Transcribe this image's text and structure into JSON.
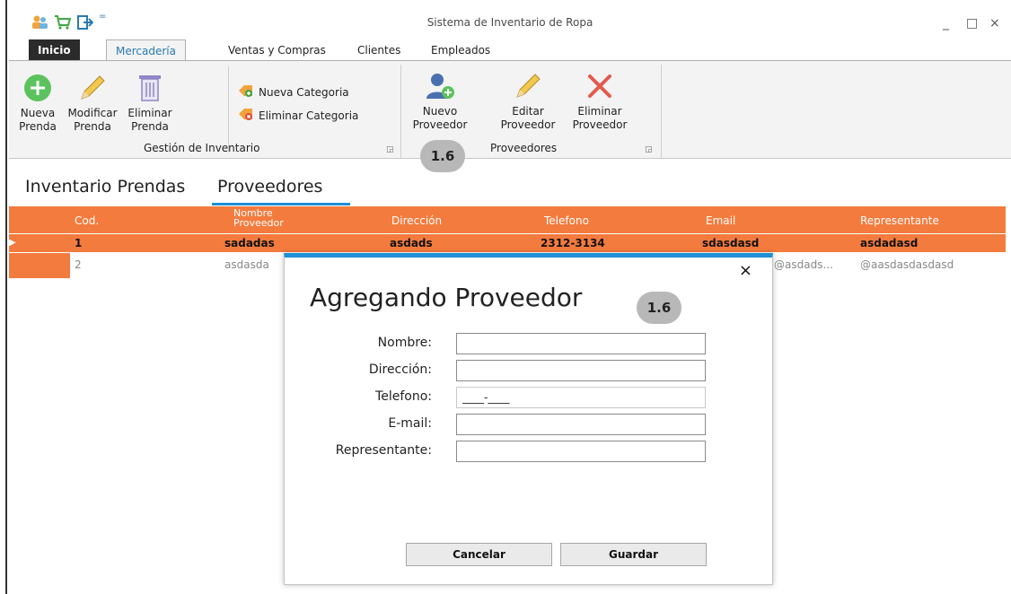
{
  "window": {
    "title": "Sistema de Inventario de Ropa"
  },
  "quick_access": [
    {
      "icon": "users-icon"
    },
    {
      "icon": "cart-icon"
    },
    {
      "icon": "exit-icon"
    },
    {
      "icon": "dropdown-arrow-icon",
      "label": "="
    }
  ],
  "window_controls": {
    "minimize": "_",
    "maximize": "□",
    "close": "×"
  },
  "tabs": [
    {
      "label": "Inicio"
    },
    {
      "label": "Mercadería"
    },
    {
      "label": "Ventas y Compras"
    },
    {
      "label": "Clientes"
    },
    {
      "label": "Empleados"
    }
  ],
  "ribbon": {
    "inventory_group": {
      "label": "Gestión de Inventario",
      "nueva_prenda": {
        "line1": "Nueva",
        "line2": "Prenda"
      },
      "modificar_prenda": {
        "line1": "Modificar",
        "line2": "Prenda"
      },
      "eliminar_prenda": {
        "line1": "Eliminar",
        "line2": "Prenda"
      },
      "nueva_categoria": "Nueva Categoria",
      "eliminar_categoria": "Eliminar Categoria"
    },
    "suppliers_group": {
      "label": "Proveedores",
      "nuevo_proveedor": {
        "line1": "Nuevo",
        "line2": "Proveedor"
      },
      "editar_proveedor": {
        "line1": "Editar",
        "line2": "Proveedor"
      },
      "eliminar_proveedor": {
        "line1": "Eliminar",
        "line2": "Proveedor"
      }
    },
    "step_badge": "1.6"
  },
  "doc_tabs": [
    {
      "label": "Inventario Prendas"
    },
    {
      "label": "Proveedores"
    }
  ],
  "grid": {
    "columns": [
      {
        "line1": "Cod."
      },
      {
        "line1": "Nombre",
        "line2": "Proveedor"
      },
      {
        "line1": "Dirección"
      },
      {
        "line1": "Telefono"
      },
      {
        "line1": "Email"
      },
      {
        "line1": "Representante"
      }
    ],
    "rows": [
      {
        "cod": "1",
        "nombre": "sadadas",
        "direccion": "asdads",
        "telefono": "2312-3134",
        "email": "sdasdasd",
        "representante": "asdadasd"
      },
      {
        "cod": "2",
        "nombre": "asdasda",
        "email": "@asdads...",
        "representante": "@aasdasdasdasd"
      }
    ]
  },
  "dialog": {
    "title": "Agregando Proveedor",
    "badge": "1.6",
    "close": "×",
    "fields": {
      "nombre": {
        "label": "Nombre:",
        "value": ""
      },
      "direccion": {
        "label": "Dirección:",
        "value": ""
      },
      "telefono": {
        "label": "Telefono:",
        "value": "____-____"
      },
      "email": {
        "label": "E-mail:",
        "value": ""
      },
      "representante": {
        "label": "Representante:",
        "value": ""
      }
    },
    "buttons": {
      "cancel": "Cancelar",
      "save": "Guardar"
    }
  },
  "colors": {
    "accent": "#1f8fd6",
    "grid_header": "#f47b3e",
    "badge": "#b8b8b8"
  }
}
